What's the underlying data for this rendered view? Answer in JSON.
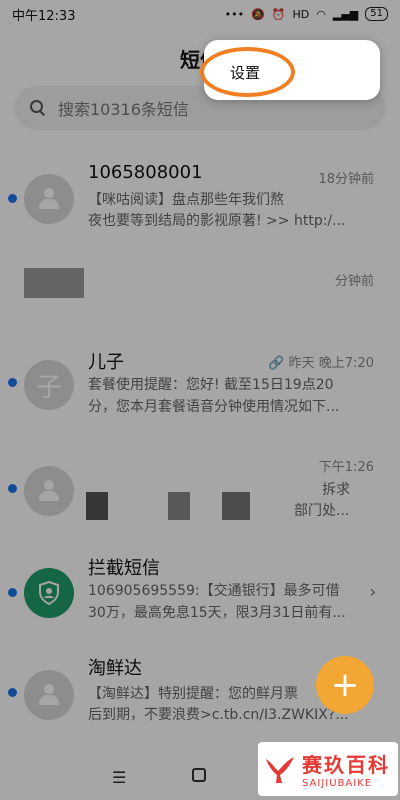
{
  "status_bar": {
    "time": "中午12:33",
    "icons": [
      "more-dots-icon",
      "mute-bell-icon",
      "alarm-icon",
      "hd-icon",
      "wifi-icon",
      "signal-icon"
    ],
    "battery": "51"
  },
  "header": {
    "title": "短信"
  },
  "search": {
    "placeholder": "搜索10316条短信"
  },
  "popup_menu": {
    "items": [
      {
        "label": "设置"
      }
    ]
  },
  "highlight_color": "#f07f22",
  "conversations": [
    {
      "sender": "1065808001",
      "time": "18分钟前",
      "preview_line1": "【咪咕阅读】盘点那些年我们熬",
      "preview_line2": "夜也要等到结局的影视原著! >> http:/...",
      "unread": true,
      "avatar": "person-icon"
    },
    {
      "sender": "",
      "time": "分钟前",
      "preview_line1": "",
      "preview_line2": "",
      "unread": false,
      "avatar": "blurred"
    },
    {
      "sender": "儿子",
      "time": "昨天 晚上7:20",
      "preview_line1": "套餐使用提醒：您好! 截至15日19点20",
      "preview_line2": "分，您本月套餐语音分钟使用情况如下...",
      "unread": true,
      "avatar": "子",
      "has_attachment": true
    },
    {
      "sender": "",
      "time": "下午1:26",
      "preview_line1": "拆求",
      "preview_line2": "部门处...",
      "unread": true,
      "avatar": "person-icon"
    },
    {
      "sender": "拦截短信",
      "time": "",
      "preview_line1": "106905695559:【交通银行】最多可借",
      "preview_line2": "30万，最高免息15天，限3月31日前有...",
      "unread": true,
      "avatar": "shield-icon"
    },
    {
      "sender": "淘鲜达",
      "time": "",
      "preview_line1": "【淘鲜达】特别提醒：您的鲜月票",
      "preview_line2": "后到期，不要浪费>c.tb.cn/I3.ZWKIX?...",
      "unread": true,
      "avatar": "person-icon"
    }
  ],
  "fab": {
    "label": "+"
  },
  "watermark": {
    "cn": "赛玖百科",
    "en": "SAIJIUBAIKE"
  }
}
